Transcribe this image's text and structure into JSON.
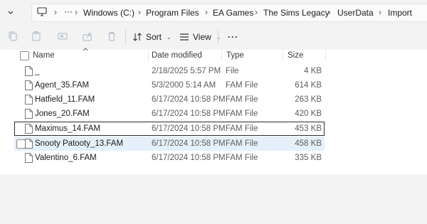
{
  "address": {
    "icon": "computer-icon",
    "overflow": "···",
    "crumbs": [
      "Windows (C:)",
      "Program Files",
      "EA Games",
      "The Sims Legacy",
      "UserData",
      "Import"
    ]
  },
  "toolbar": {
    "sort_label": "Sort",
    "view_label": "View",
    "more_label": "···"
  },
  "columns": {
    "name": "Name",
    "date": "Date modified",
    "type": "Type",
    "size": "Size"
  },
  "files": [
    {
      "name": "_",
      "date": "2/18/2025 5:57 PM",
      "type": "File",
      "size": "4 KB"
    },
    {
      "name": "Agent_35.FAM",
      "date": "5/3/2000 5:14 AM",
      "type": "FAM File",
      "size": "614 KB"
    },
    {
      "name": "Hatfield_11.FAM",
      "date": "6/17/2024 10:58 PM",
      "type": "FAM File",
      "size": "263 KB"
    },
    {
      "name": "Jones_20.FAM",
      "date": "6/17/2024 10:58 PM",
      "type": "FAM File",
      "size": "420 KB"
    },
    {
      "name": "Maximus_14.FAM",
      "date": "6/17/2024 10:58 PM",
      "type": "FAM File",
      "size": "453 KB"
    },
    {
      "name": "Snooty Patooty_13.FAM",
      "date": "6/17/2024 10:58 PM",
      "type": "FAM File",
      "size": "458 KB"
    },
    {
      "name": "Valentino_6.FAM",
      "date": "6/17/2024 10:58 PM",
      "type": "FAM File",
      "size": "335 KB"
    }
  ],
  "colors": {
    "hover_row": "#e5f0fb",
    "focus_border": "#2b2b2b",
    "background": "#f3f3f3"
  }
}
